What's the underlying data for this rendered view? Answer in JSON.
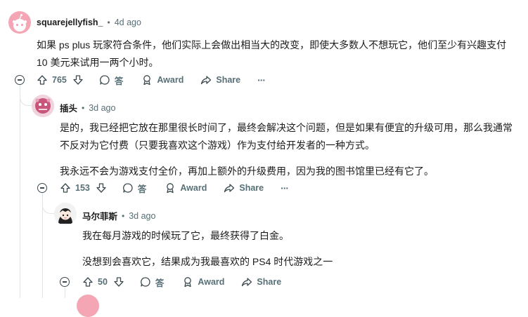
{
  "comments": [
    {
      "username": "squarejellyfish_",
      "time": "4d ago",
      "paragraphs": [
        "如果 ps plus 玩家符合条件，他们实际上会做出相当大的改变，即使大多数人不想玩它，他们至少有兴趣支付",
        "10 美元来试用一两个小时。"
      ],
      "votes": "765",
      "reply_label": "答",
      "award_label": "Award",
      "share_label": "Share",
      "more_label": "···"
    },
    {
      "username": "插头",
      "time": "3d ago",
      "paragraphs": [
        "是的，我已经把它放在那里很长时间了，最终会解决这个问题，但是如果有便宜的升级可用，那么我通常",
        "不反对为它付费（只要我喜欢这个游戏）作为支付给开发者的一种方式。",
        "我永远不会为游戏支付全价，再加上额外的升级费用，因为我的图书馆里已经有它了。"
      ],
      "votes": "153",
      "reply_label": "答",
      "award_label": "Award",
      "share_label": "Share",
      "more_label": "···"
    },
    {
      "username": "马尔菲斯",
      "time": "3d ago",
      "paragraphs": [
        "我在每月游戏的时候玩了它，最终获得了白金。",
        "没想到会喜欢它，结果成为我最喜欢的 PS4 时代游戏之一"
      ],
      "votes": "50",
      "reply_label": "答",
      "award_label": "Award",
      "share_label": "Share"
    }
  ],
  "separator": "•",
  "colors": {
    "text": "#1c1c1c",
    "meta": "#576f76",
    "thread_line": "#e0e4e6",
    "avatar1_bg": "#f4a6b5"
  }
}
